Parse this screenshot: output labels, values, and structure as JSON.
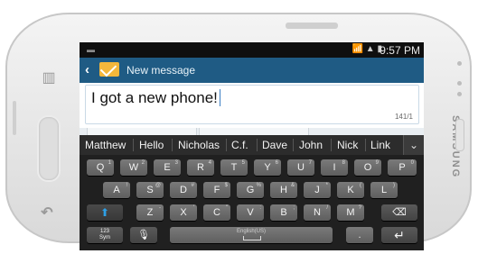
{
  "status_bar": {
    "left_indicator": "▬",
    "icons": "📶 ▲ ▮",
    "time": "9:57 PM"
  },
  "app_bar": {
    "back_glyph": "‹",
    "title": "New message"
  },
  "compose": {
    "text": "I got a new phone!",
    "counter": "141/1"
  },
  "suggestions": {
    "words": [
      "Matthew",
      "Hello",
      "Nicholas",
      "C.f.",
      "Dave",
      "John",
      "Nick",
      "Link"
    ],
    "expand_glyph": "⌄"
  },
  "keyboard": {
    "row1": [
      {
        "label": "Q",
        "sub": "1"
      },
      {
        "label": "W",
        "sub": "2"
      },
      {
        "label": "E",
        "sub": "3"
      },
      {
        "label": "R",
        "sub": "4"
      },
      {
        "label": "T",
        "sub": "5"
      },
      {
        "label": "Y",
        "sub": "6"
      },
      {
        "label": "U",
        "sub": "7"
      },
      {
        "label": "I",
        "sub": "8"
      },
      {
        "label": "O",
        "sub": "9"
      },
      {
        "label": "P",
        "sub": "0"
      }
    ],
    "row2": [
      {
        "label": "A",
        "sub": "!"
      },
      {
        "label": "S",
        "sub": "@"
      },
      {
        "label": "D",
        "sub": "#"
      },
      {
        "label": "F",
        "sub": "$"
      },
      {
        "label": "G",
        "sub": "%"
      },
      {
        "label": "H",
        "sub": "&"
      },
      {
        "label": "J",
        "sub": "*"
      },
      {
        "label": "K",
        "sub": "("
      },
      {
        "label": "L",
        "sub": ")"
      }
    ],
    "row3": [
      {
        "label": "Z",
        "sub": "-"
      },
      {
        "label": "X",
        "sub": "'"
      },
      {
        "label": "C",
        "sub": "\""
      },
      {
        "label": "V",
        "sub": ":"
      },
      {
        "label": "B",
        "sub": ";"
      },
      {
        "label": "N",
        "sub": "/"
      },
      {
        "label": "M",
        "sub": "?"
      }
    ],
    "shift_glyph": "⬆",
    "backspace_glyph": "⌫",
    "sym_label": "123\nSym",
    "mic_glyph": "🎙",
    "space_label": "English(US)",
    "period_label": ".",
    "enter_glyph": "↵"
  },
  "device": {
    "brand": "SAMSUNG",
    "menu_key_glyph": "▥",
    "back_key_glyph": "↶"
  },
  "colors": {
    "appbar": "#1f5b84",
    "accent": "#2ea0e6"
  }
}
